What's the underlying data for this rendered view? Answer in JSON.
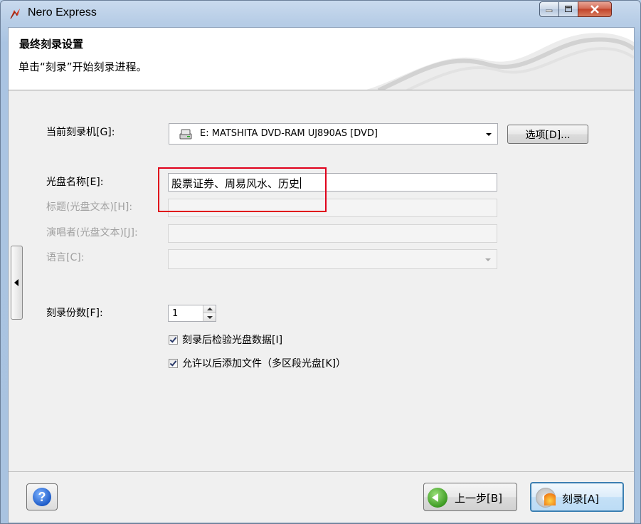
{
  "window": {
    "title": "Nero Express"
  },
  "header": {
    "title": "最终刻录设置",
    "subtitle": "单击“刻录”开始刻录进程。"
  },
  "form": {
    "recorder_label": "当前刻录机[G]:",
    "recorder_value": "E: MATSHITA DVD-RAM UJ890AS   [DVD]",
    "options_button": "选项[D]...",
    "disc_name_label": "光盘名称[E]:",
    "disc_name_value": "股票证券、周易风水、历史",
    "title_label": "标题(光盘文本)[H]:",
    "artist_label": "演唱者(光盘文本)[J]:",
    "language_label": "语言[C]:",
    "copies_label": "刻录份数[F]:",
    "copies_value": "1",
    "verify_label": "刻录后检验光盘数据[I]",
    "verify_checked": true,
    "multisession_label": "允许以后添加文件（多区段光盘[K]）",
    "multisession_checked": true
  },
  "footer": {
    "back_button": "上一步[B]",
    "burn_button": "刻录[A]"
  },
  "colors": {
    "highlight_box": "#e0001b",
    "title_bar": "#b7cde6",
    "client_bg": "#f0f0f0"
  },
  "icons": [
    "nero-logo-icon",
    "minimize-icon",
    "maximize-icon",
    "close-icon",
    "drive-icon",
    "dropdown-icon",
    "help-icon",
    "back-arrow-icon",
    "burn-disc-icon",
    "collapse-arrow-icon"
  ]
}
